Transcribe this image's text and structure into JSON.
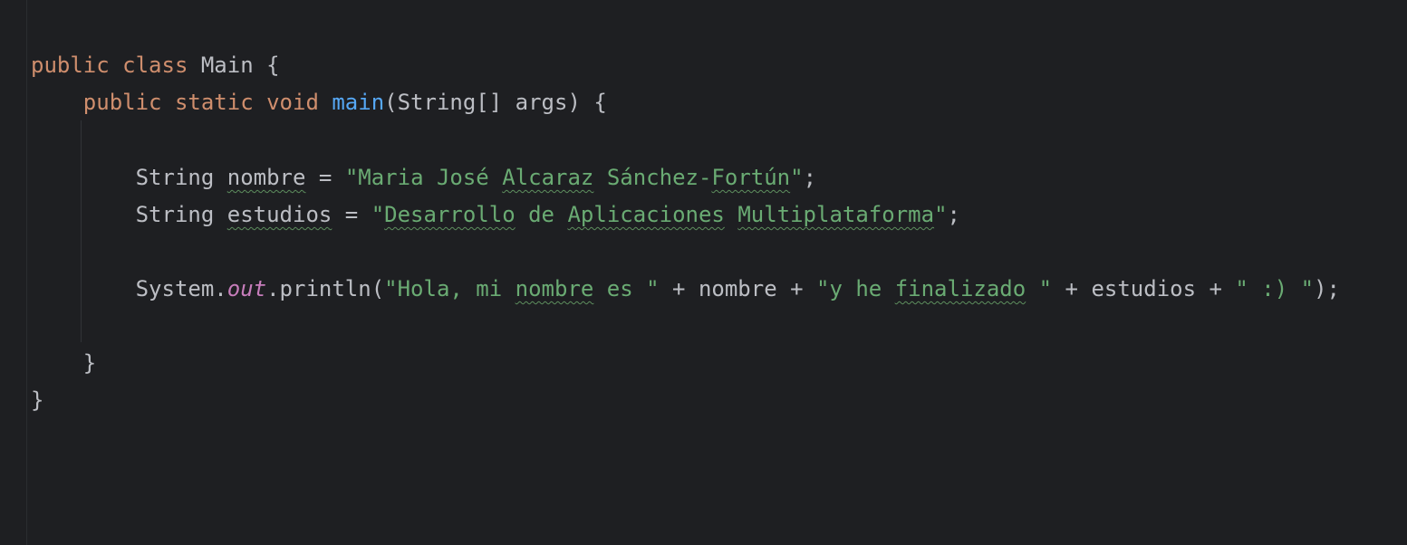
{
  "editor": {
    "colors": {
      "background": "#1e1f22",
      "keyword": "#cf8e6d",
      "method": "#56a8f5",
      "string": "#6aab73",
      "static_field": "#c77dbb",
      "plain": "#bcbec4",
      "typo_underline": "#5e8f5e"
    },
    "line1": {
      "kw_public": "public",
      "kw_class": "class",
      "class_name": "Main",
      "brace_open": "{"
    },
    "line2": {
      "kw_public": "public",
      "kw_static": "static",
      "kw_void": "void",
      "method_name": "main",
      "params": "(String[] args)",
      "brace_open": "{"
    },
    "line3": {
      "type": "String",
      "var_name": "nombre",
      "assign": " = ",
      "str_quote_open": "\"",
      "str_w1": "Maria José",
      "str_w2": "Alcaraz",
      "str_w3": "Sánchez-",
      "str_w4": "Fortún",
      "str_quote_close": "\"",
      "semicolon": ";"
    },
    "line4": {
      "type": "String",
      "var_name": "estudios",
      "assign": " = ",
      "str_quote_open": "\"",
      "str_w1": "Desarrollo",
      "str_w2": "de",
      "str_w3": "Aplicaciones",
      "str_w4": "Multiplataforma",
      "str_quote_close": "\"",
      "semicolon": ";"
    },
    "line5": {
      "system": "System.",
      "out": "out",
      "println": ".println(",
      "s1_a": "\"Hola, mi ",
      "s1_b": "nombre",
      "s1_c": " es \"",
      "concat1": " + nombre + ",
      "s2_a": "\"y he ",
      "s2_b": "finalizado",
      "s2_c": " \"",
      "concat2": " + estudios + ",
      "s3": "\" :) \"",
      "close": ");"
    },
    "line6": {
      "brace_close": "}"
    },
    "line7": {
      "brace_close": "}"
    }
  }
}
